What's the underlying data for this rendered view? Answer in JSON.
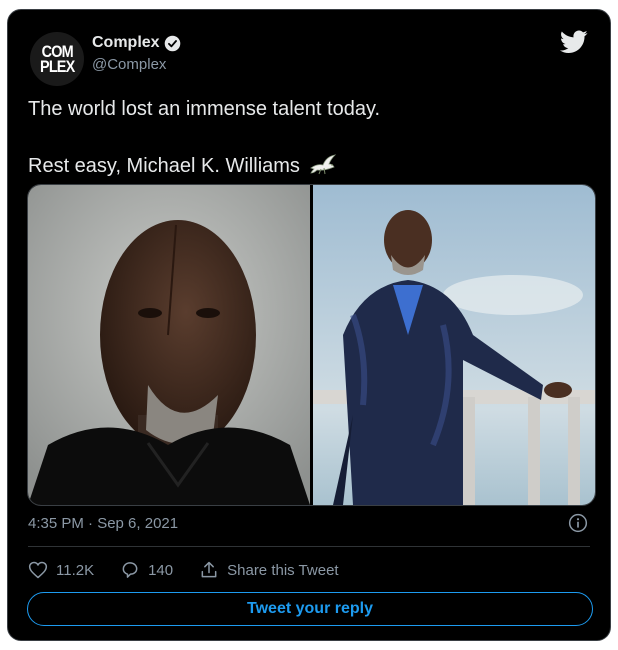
{
  "tweet": {
    "author": {
      "display_name": "Complex",
      "handle": "@Complex",
      "avatar_text_line1": "COM",
      "avatar_text_line2": "PLEX",
      "verified_icon": "verified-badge-icon"
    },
    "text_line1": "The world lost an immense talent today.",
    "text_line2": "Rest easy, Michael K. Williams",
    "emoji_icon": "dove-icon",
    "timestamp": "4:35 PM · Sep 6, 2021",
    "likes": "11.2K",
    "replies": "140",
    "share_label": "Share this Tweet",
    "reply_button_label": "Tweet your reply"
  },
  "colors": {
    "background": "#000000",
    "text": "#e7e9ea",
    "muted": "#8b98a5",
    "accent": "#1d9bf0",
    "border": "#3a3f44"
  }
}
